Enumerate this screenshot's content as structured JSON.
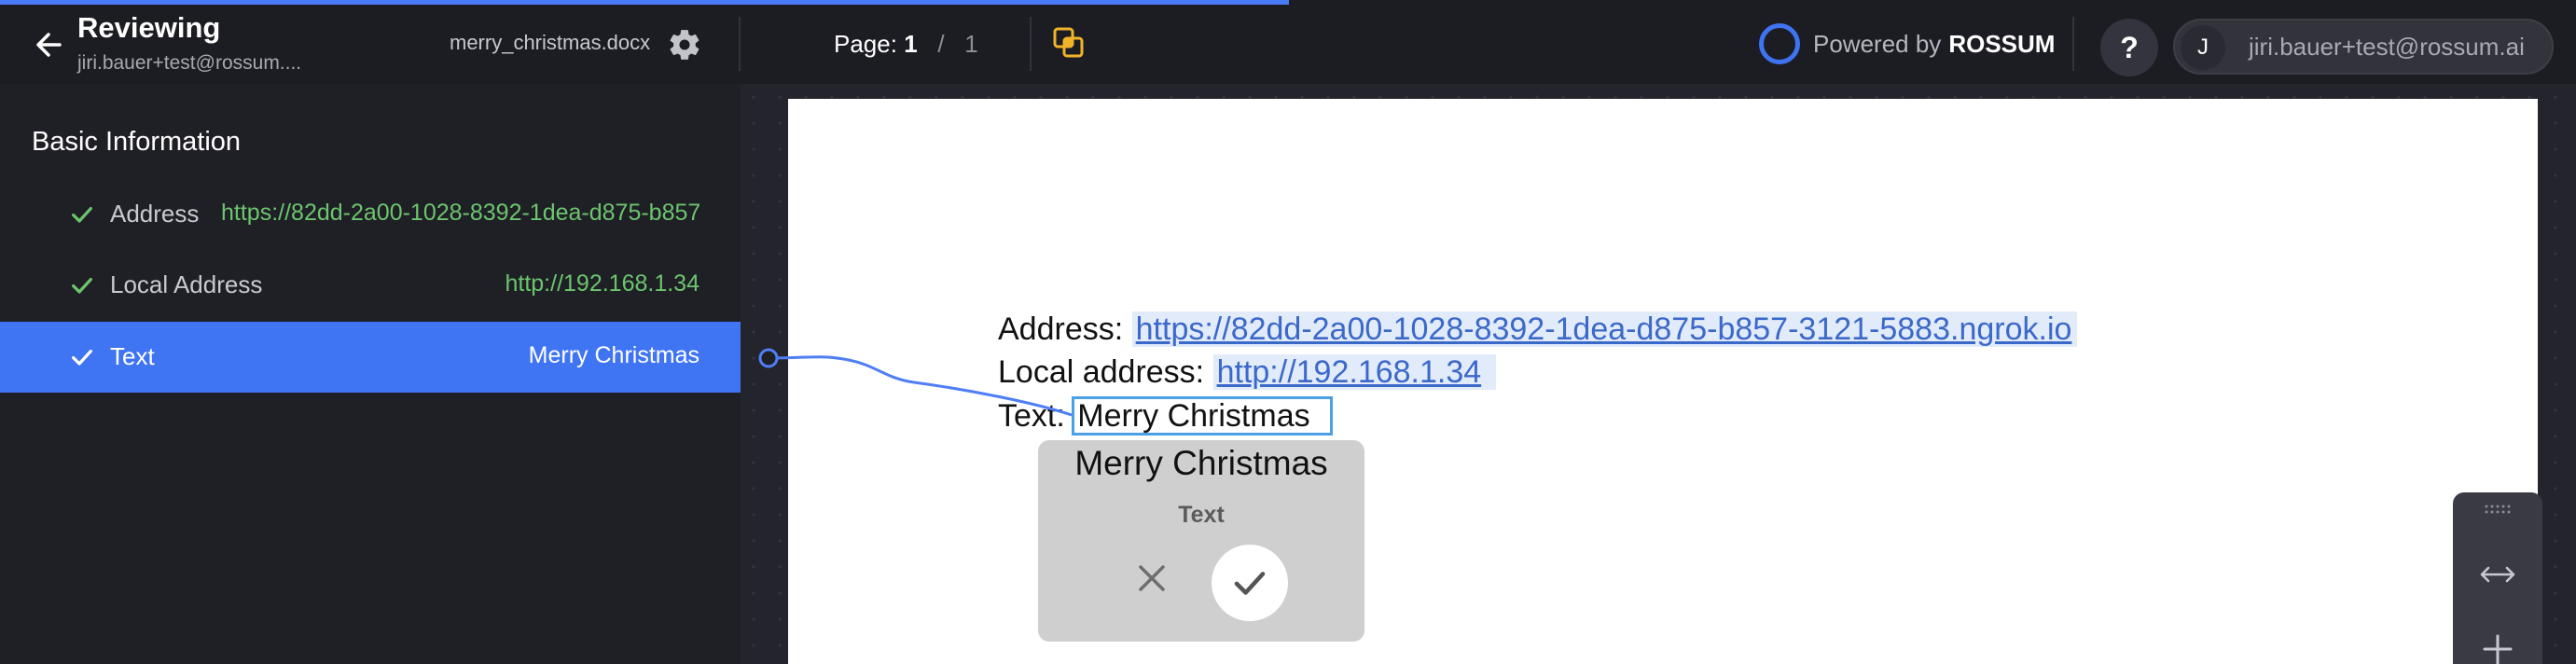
{
  "header": {
    "title": "Reviewing",
    "subtitle": "jiri.bauer+test@rossum....",
    "filename": "merry_christmas.docx",
    "page_label": "Page:",
    "page_current": "1",
    "page_sep": "/",
    "page_total": "1",
    "powered_by": "Powered by",
    "brand": "ROSSUM",
    "help": "?",
    "user_initial": "J",
    "user_email": "jiri.bauer+test@rossum.ai"
  },
  "sidebar": {
    "section_title": "Basic Information",
    "fields": [
      {
        "label": "Address",
        "value": "https://82dd-2a00-1028-8392-1dea-d875-b857-3121-5883.ngrok.io"
      },
      {
        "label": "Local Address",
        "value": "http://192.168.1.34"
      },
      {
        "label": "Text",
        "value": "Merry Christmas"
      }
    ]
  },
  "document": {
    "lines": [
      {
        "key": "Address:",
        "value": "https://82dd-2a00-1028-8392-1dea-d875-b857-3121-5883.ngrok.io"
      },
      {
        "key": "Local address:",
        "value": "http://192.168.1.34"
      },
      {
        "key": "Text:",
        "value": "Merry Christmas"
      }
    ]
  },
  "popup": {
    "value": "Merry Christmas",
    "label": "Text"
  },
  "colors": {
    "accent": "#3f74f2",
    "progress": "#4a7bf7",
    "valid_value": "#6cc56d",
    "selection": "#4aa0e6",
    "compare_icon": "#f0b429"
  },
  "icons": {
    "back": "arrow-left-icon",
    "settings": "gear-icon",
    "compare": "compare-pages-icon",
    "validated": "check-icon",
    "reject": "close-icon",
    "accept": "check-icon",
    "fit": "fit-width-icon",
    "zoom_in": "plus-icon"
  },
  "progress": 0.5
}
